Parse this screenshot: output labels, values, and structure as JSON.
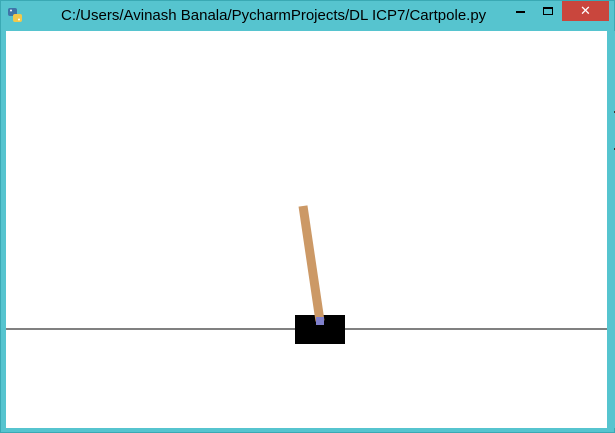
{
  "window": {
    "title": "C:/Users/Avinash Banala/PycharmProjects/DL ICP7/Cartpole.py",
    "icon": "python-icon",
    "controls": {
      "minimize_icon": "minimize-icon",
      "maximize_icon": "maximize-icon",
      "close_label": "✕"
    }
  },
  "scene": {
    "track_color": "#000000",
    "cart_color": "#000000",
    "pole_color": "#cc9966",
    "axle_color": "#8080cc",
    "background": "#ffffff"
  },
  "colors": {
    "titlebar": "#56c4cf",
    "close_button": "#c9463d"
  }
}
